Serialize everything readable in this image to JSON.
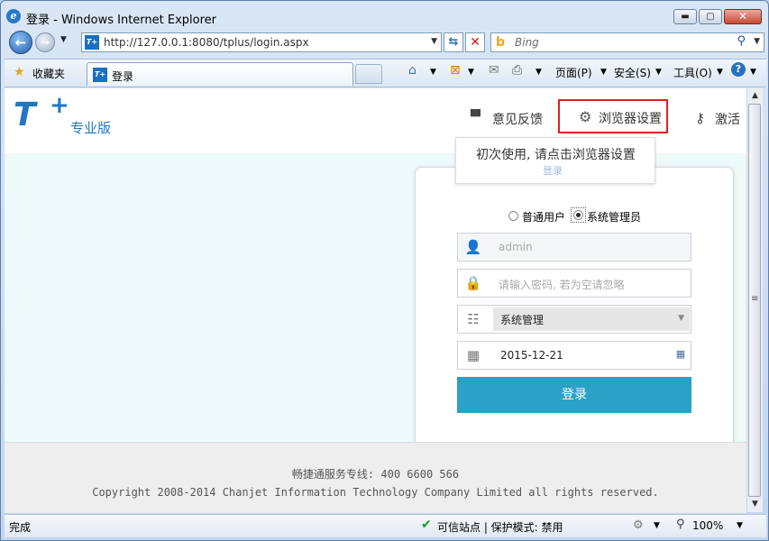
{
  "window": {
    "title": "登录 - Windows Internet Explorer",
    "min_glyph": "▬",
    "max_glyph": "▢",
    "close_glyph": "✕"
  },
  "address": {
    "url": "http://127.0.0.1:8080/tplus/login.aspx"
  },
  "search": {
    "placeholder": "Bing"
  },
  "favorites": {
    "label": "收藏夹"
  },
  "tab": {
    "label": "登录",
    "icon_text": "T+"
  },
  "commands": {
    "page": "页面(P)",
    "safety": "安全(S)",
    "tools": "工具(O)"
  },
  "header": {
    "logo": "T",
    "logo_plus": "+",
    "edition": "专业版",
    "feedback": "意见反馈",
    "browser_settings": "浏览器设置",
    "activate": "激活"
  },
  "tooltip": {
    "text": "初次使用, 请点击浏览器设置",
    "faded_text": "登录"
  },
  "login": {
    "role_normal": "普通用户",
    "role_admin": "系统管理员",
    "selected_role": "系统管理员",
    "username_placeholder": "admin",
    "password_placeholder": "请输入密码, 若为空请忽略",
    "org_value": "系统管理",
    "date_value": "2015-12-21",
    "submit": "登录"
  },
  "footer": {
    "hotline": "畅捷通服务专线: 400 6600 566",
    "copyright": "Copyright 2008-2014 Chanjet Information Technology Company Limited all rights reserved."
  },
  "status": {
    "text": "完成",
    "zone": "可信站点 | 保护模式: 禁用",
    "zoom": "100%"
  },
  "colors": {
    "brand": "#1f77c2",
    "login_button": "#2aa2c8",
    "highlight_border": "#e02020",
    "hero_background": "#eef9fa"
  },
  "icons": [
    "ie-icon",
    "back-icon",
    "forward-icon",
    "refresh-icon",
    "stop-icon",
    "bing-icon",
    "search-icon",
    "favorites-star-icon",
    "home-icon",
    "rss-icon",
    "mail-icon",
    "print-icon",
    "help-icon",
    "feedback-icon",
    "gear-icon",
    "key-icon",
    "user-icon",
    "lock-icon",
    "list-icon",
    "calendar-icon",
    "check-icon"
  ]
}
